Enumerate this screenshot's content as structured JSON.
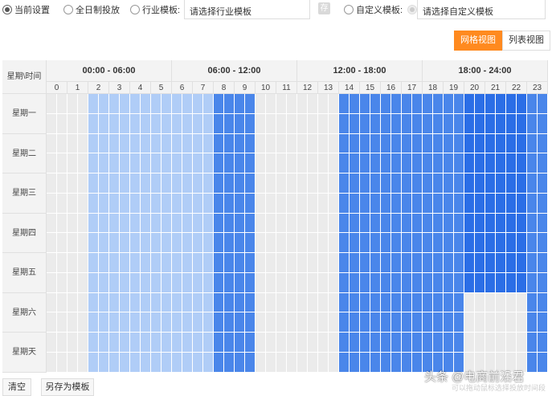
{
  "options": {
    "current_settings": "当前设置",
    "all_day": "全日制投放",
    "industry_template": "行业模板:",
    "industry_placeholder": "请选择行业模板",
    "save_icon_text": "存",
    "custom_template": "自定义模板:",
    "custom_placeholder": "请选择自定义模板"
  },
  "view": {
    "grid": "网格视图",
    "list": "列表视图"
  },
  "grid": {
    "corner": "星期\\时间",
    "ranges": [
      "00:00 - 06:00",
      "06:00 - 12:00",
      "12:00 - 18:00",
      "18:00 - 24:00"
    ],
    "hours": [
      "0",
      "1",
      "2",
      "3",
      "4",
      "5",
      "6",
      "7",
      "8",
      "9",
      "10",
      "11",
      "12",
      "13",
      "14",
      "15",
      "16",
      "17",
      "18",
      "19",
      "20",
      "21",
      "22",
      "23"
    ],
    "days": [
      "星期一",
      "星期二",
      "星期三",
      "星期四",
      "星期五",
      "星期六",
      "星期天"
    ],
    "hour_state": [
      0,
      0,
      1,
      1,
      1,
      1,
      1,
      1,
      2,
      2,
      0,
      0,
      0,
      0,
      2,
      2,
      2,
      2,
      2,
      2,
      3,
      3,
      3,
      2
    ],
    "weekend_hour_state": [
      0,
      0,
      1,
      1,
      1,
      1,
      1,
      1,
      2,
      2,
      0,
      0,
      0,
      0,
      2,
      2,
      2,
      2,
      2,
      2,
      0,
      0,
      0,
      2
    ],
    "weekend_days": [
      5,
      6
    ],
    "colors": {
      "unselected": "#ebebeb",
      "light": "#b0cdf7",
      "medium": "#4a86ea",
      "strong": "#2b6ee6",
      "accent": "#ff8a1f"
    }
  },
  "actions": {
    "clear": "清空",
    "save_as_template": "另存为模板",
    "hint": "可以拖动鼠标选择投放时间段"
  },
  "watermark": "头条 @电商前沿君"
}
